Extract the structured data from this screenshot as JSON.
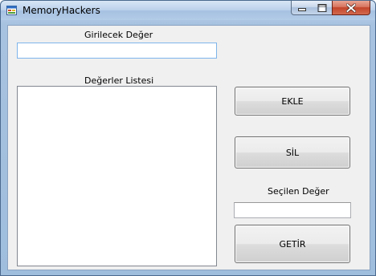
{
  "window": {
    "title": "MemoryHackers",
    "icon": "windows-form-icon"
  },
  "titlebar_buttons": {
    "minimize": "minimize-icon",
    "maximize": "maximize-icon",
    "close": "close-icon"
  },
  "form": {
    "input_label": "Girilecek Değer",
    "input_value": "",
    "list_label": "Değerler Listesi",
    "list_items": [],
    "add_button": "EKLE",
    "delete_button": "SİL",
    "selected_label": "Seçilen Değer",
    "selected_value": "",
    "get_button": "GETİR"
  }
}
